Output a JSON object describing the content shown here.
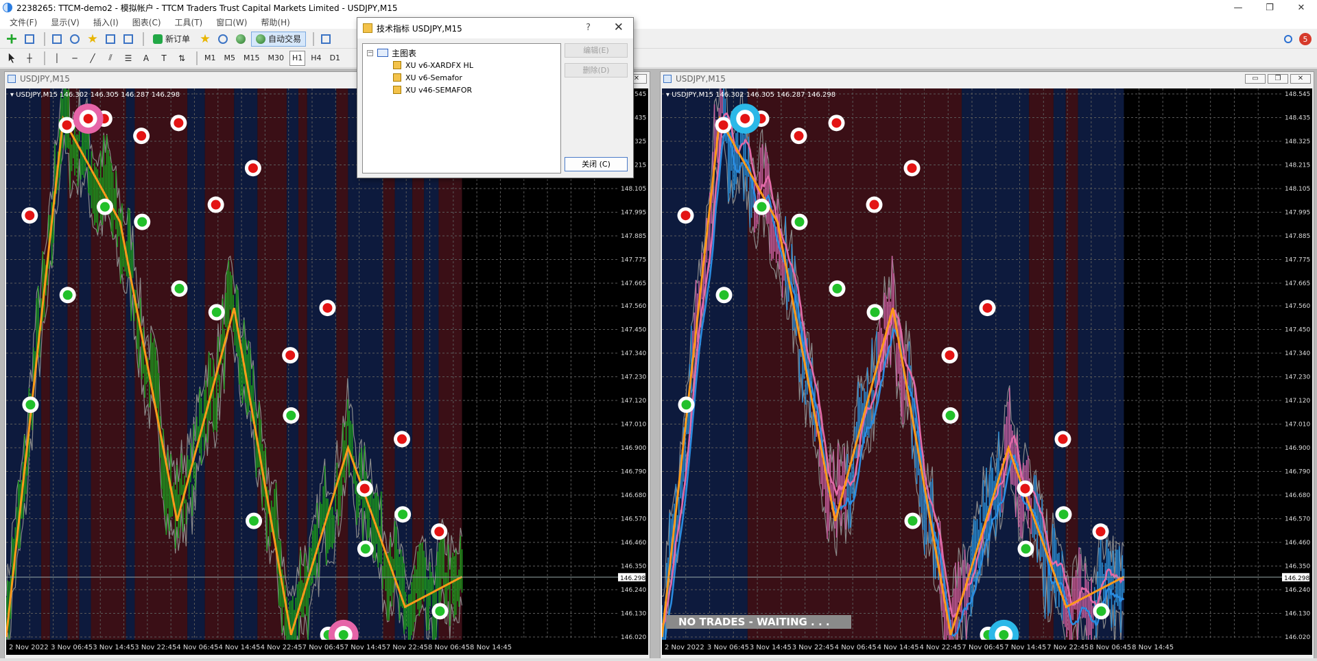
{
  "window": {
    "title": "2238265: TTCM-demo2 - 模拟帐户 - TTCM Traders Trust Capital Markets Limited - USDJPY,M15",
    "controls": [
      "—",
      "❐",
      "✕"
    ]
  },
  "menu": [
    "文件(F)",
    "显示(V)",
    "插入(I)",
    "图表(C)",
    "工具(T)",
    "窗口(W)",
    "帮助(H)"
  ],
  "toolbar": {
    "new_order": "新订单",
    "auto_trade": "自动交易",
    "timeframes": [
      "M1",
      "M5",
      "M15",
      "M30",
      "H1",
      "H4",
      "D1"
    ],
    "active_timeframe": "H1",
    "notification_count": "5"
  },
  "dialog": {
    "title": "技术指标 USDJPY,M15",
    "help": "?",
    "close_x": "✕",
    "root_label": "主图表",
    "indicators": [
      "XU v6-XARDFX HL",
      "XU v6-Semafor",
      "XU v46-SEMAFOR"
    ],
    "edit_button": "编辑(E)",
    "delete_button": "删除(D)",
    "close_button": "关闭 (C)"
  },
  "charts": [
    {
      "window_title": "USDJPY,M15",
      "header": "USDJPY,M15  146.302 146.305 146.287 146.298",
      "price_tag": "146.298",
      "overlay_text": ""
    },
    {
      "window_title": "USDJPY,M15",
      "header": "USDJPY,M15  146.302 146.305 146.287 146.298",
      "price_tag": "146.298",
      "overlay_text": "NO TRADES - WAITING . . ."
    }
  ],
  "chart_data": {
    "type": "candlestick",
    "symbol": "USDJPY",
    "timeframe": "M15",
    "ylim": [
      146.02,
      148.545
    ],
    "y_ticks": [
      "148.545",
      "148.435",
      "148.325",
      "148.215",
      "148.105",
      "147.995",
      "147.885",
      "147.775",
      "147.665",
      "147.560",
      "147.450",
      "147.340",
      "147.230",
      "147.120",
      "147.010",
      "146.900",
      "146.790",
      "146.680",
      "146.570",
      "146.460",
      "146.350",
      "146.240",
      "146.130",
      "146.020"
    ],
    "x_ticks": [
      "2 Nov 2022",
      "3 Nov 06:45",
      "3 Nov 14:45",
      "3 Nov 22:45",
      "4 Nov 06:45",
      "4 Nov 14:45",
      "4 Nov 22:45",
      "7 Nov 06:45",
      "7 Nov 14:45",
      "7 Nov 22:45",
      "8 Nov 06:45",
      "8 Nov 14:45"
    ],
    "last_price": 146.298,
    "zigzag": [
      146.02,
      148.43,
      147.95,
      146.56,
      147.55,
      146.03,
      146.9,
      146.16,
      146.3
    ],
    "high_markers": [
      147.98,
      148.4,
      148.43,
      148.35,
      148.41,
      148.03,
      148.2,
      147.33,
      147.55,
      146.71,
      146.94,
      146.51
    ],
    "low_markers": [
      147.1,
      147.61,
      148.02,
      147.95,
      147.64,
      147.53,
      146.56,
      147.05,
      146.03,
      146.43,
      146.59,
      146.14
    ]
  }
}
